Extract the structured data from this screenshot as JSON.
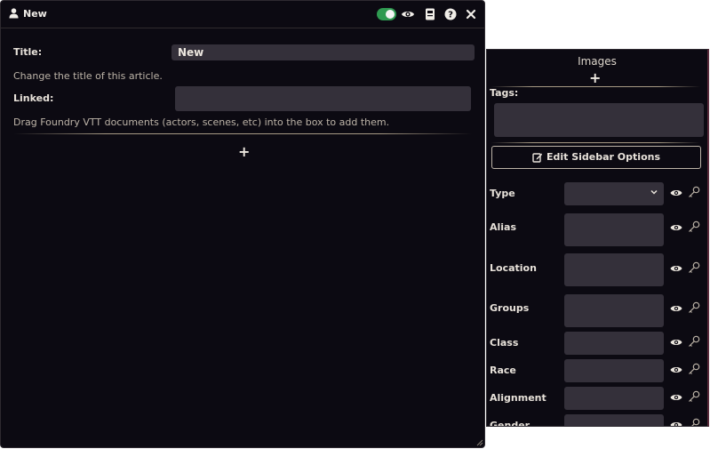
{
  "window": {
    "title": "New",
    "fields": {
      "title_label": "Title:",
      "title_value": "New",
      "title_hint": "Change the title of this article.",
      "linked_label": "Linked:",
      "linked_hint": "Drag Foundry VTT documents (actors, scenes, etc) into the box to add them."
    },
    "add_symbol": "+"
  },
  "sidebar": {
    "header": "Images",
    "add_symbol": "+",
    "tags_label": "Tags:",
    "edit_button": "Edit Sidebar Options",
    "properties": [
      {
        "label": "Type"
      },
      {
        "label": "Alias"
      },
      {
        "label": "Location"
      },
      {
        "label": "Groups"
      },
      {
        "label": "Class"
      },
      {
        "label": "Race"
      },
      {
        "label": "Alignment"
      },
      {
        "label": "Gender"
      }
    ]
  },
  "colors": {
    "background": "#0c0a12",
    "input": "#34303a",
    "toggle_on": "#2f9a51",
    "text": "#e8e2da"
  }
}
